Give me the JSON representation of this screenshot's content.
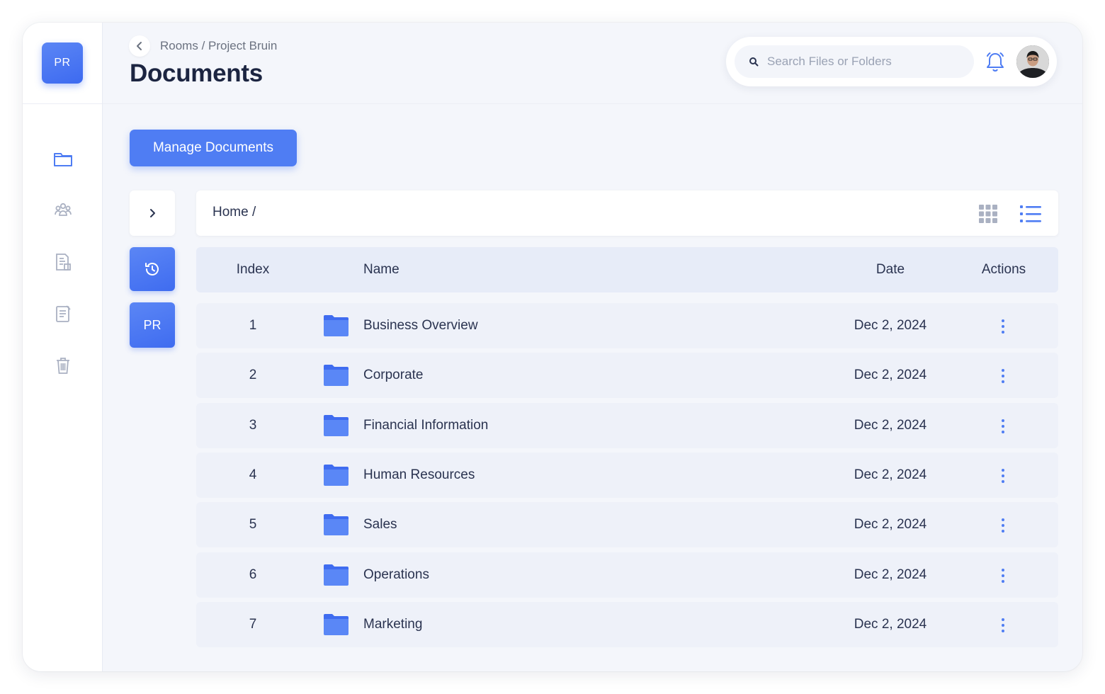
{
  "sidebar": {
    "logo_text": "PR",
    "nav_items": [
      {
        "icon": "folder-icon",
        "active": true
      },
      {
        "icon": "team-icon",
        "active": false
      },
      {
        "icon": "building-report-icon",
        "active": false
      },
      {
        "icon": "notes-icon",
        "active": false
      },
      {
        "icon": "trash-icon",
        "active": false
      }
    ]
  },
  "header": {
    "breadcrumb": "Rooms / Project Bruin",
    "title": "Documents",
    "search_placeholder": "Search Files or Folders"
  },
  "toolbar": {
    "manage_label": "Manage Documents"
  },
  "side_actions": {
    "pr_label": "PR"
  },
  "path_bar": {
    "path": "Home /"
  },
  "table": {
    "columns": {
      "index": "Index",
      "name": "Name",
      "date": "Date",
      "actions": "Actions"
    },
    "rows": [
      {
        "index": "1",
        "name": "Business Overview",
        "date": "Dec 2, 2024"
      },
      {
        "index": "2",
        "name": "Corporate",
        "date": "Dec 2, 2024"
      },
      {
        "index": "3",
        "name": "Financial Information",
        "date": "Dec 2, 2024"
      },
      {
        "index": "4",
        "name": "Human Resources",
        "date": "Dec 2, 2024"
      },
      {
        "index": "5",
        "name": "Sales",
        "date": "Dec 2, 2024"
      },
      {
        "index": "6",
        "name": "Operations",
        "date": "Dec 2, 2024"
      },
      {
        "index": "7",
        "name": "Marketing",
        "date": "Dec 2, 2024"
      }
    ]
  },
  "colors": {
    "accent": "#4f7df3",
    "folder": "#4f7df3",
    "row_bg": "#eef1f9",
    "header_bg": "#e7ecf8"
  }
}
